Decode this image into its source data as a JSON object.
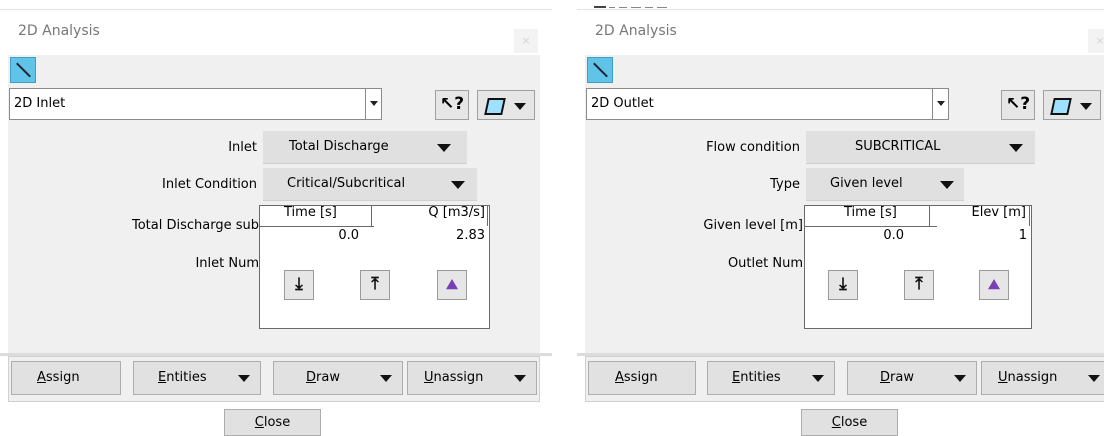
{
  "left": {
    "title": "2D Analysis",
    "close_glyph": "×",
    "tool_icon": "line-tool-icon",
    "combo_value": "2D Inlet",
    "help_glyph": "↖?",
    "rows": [
      {
        "label": "Inlet",
        "value": "Total Discharge"
      },
      {
        "label": "Inlet Condition",
        "value": "Critical/Subcritical"
      }
    ],
    "table_label": "Total Discharge sub",
    "num_label": "Inlet Num",
    "table": {
      "headers": [
        "Time [s]",
        "Q [m3/s]"
      ],
      "rows": [
        [
          "0.0",
          "2.83"
        ]
      ]
    },
    "table_buttons": [
      "import-icon",
      "export-icon",
      "chart-icon"
    ],
    "buttons": {
      "assign": {
        "ul": "A",
        "rest": "ssign"
      },
      "entities": {
        "ul": "E",
        "rest": "ntities"
      },
      "draw": {
        "ul": "D",
        "rest": "raw"
      },
      "unassign": {
        "ul": "U",
        "rest": "nassign"
      }
    },
    "close": {
      "ul": "C",
      "rest": "lose"
    }
  },
  "right": {
    "title": "2D Analysis",
    "close_glyph": "×",
    "tool_icon": "line-tool-icon",
    "combo_value": "2D Outlet",
    "help_glyph": "↖?",
    "rows": [
      {
        "label": "Flow condition",
        "value": "SUBCRITICAL"
      },
      {
        "label": "Type",
        "value": "Given level"
      }
    ],
    "table_label": "Given level [m]",
    "num_label": "Outlet Num",
    "table": {
      "headers": [
        "Time [s]",
        "Elev [m]"
      ],
      "rows": [
        [
          "0.0",
          "1"
        ]
      ]
    },
    "table_buttons": [
      "import-icon",
      "export-icon",
      "chart-icon"
    ],
    "buttons": {
      "assign": {
        "ul": "A",
        "rest": "ssign"
      },
      "entities": {
        "ul": "E",
        "rest": "ntities"
      },
      "draw": {
        "ul": "D",
        "rest": "raw"
      },
      "unassign": {
        "ul": "U",
        "rest": "nassign"
      }
    },
    "close": {
      "ul": "C",
      "rest": "lose"
    }
  }
}
